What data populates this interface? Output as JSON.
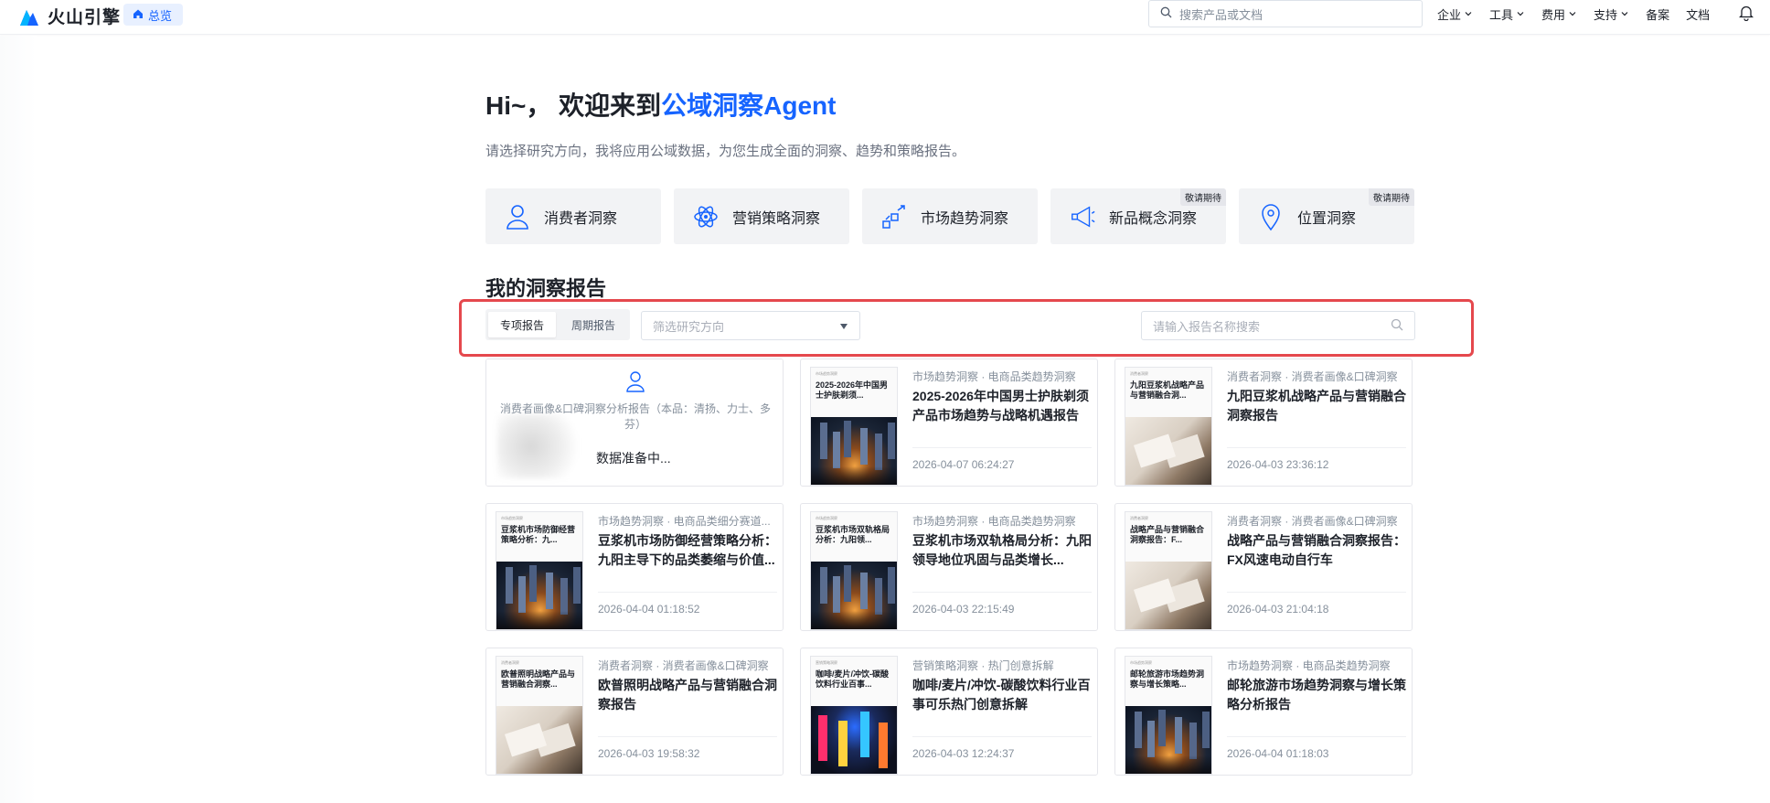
{
  "topbar": {
    "logo_text": "火山引擎",
    "home_label": "总览",
    "search_placeholder": "搜索产品或文档",
    "nav": [
      "企业",
      "工具",
      "费用",
      "支持"
    ],
    "links": [
      "备案",
      "文档"
    ]
  },
  "hero": {
    "greeting": "Hi~，  欢迎来到",
    "highlight": "公域洞察Agent",
    "subtitle": "请选择研究方向，我将应用公域数据，为您生成全面的洞察、趋势和策略报告。"
  },
  "features": [
    {
      "label": "消费者洞察",
      "icon": "person-icon",
      "badge": ""
    },
    {
      "label": "营销策略洞察",
      "icon": "atom-icon",
      "badge": ""
    },
    {
      "label": "市场趋势洞察",
      "icon": "trend-icon",
      "badge": ""
    },
    {
      "label": "新品概念洞察",
      "icon": "megaphone-icon",
      "badge": "敬请期待"
    },
    {
      "label": "位置洞察",
      "icon": "location-pin-icon",
      "badge": "敬请期待"
    }
  ],
  "reports_section": {
    "title": "我的洞察报告",
    "tabs": [
      "专项报告",
      "周期报告"
    ],
    "active_tab": "专项报告",
    "filter_placeholder": "筛选研究方向",
    "search_placeholder": "请输入报告名称搜索"
  },
  "pending_card": {
    "description": "消费者画像&口碑洞察分析报告（本品：清扬、力士、多芬）",
    "status": "数据准备中..."
  },
  "reports": [
    {
      "tags": "市场趋势洞察 · 电商品类趋势洞察",
      "title": "2025-2026年中国男士护肤剃须产品市场趋势与战略机遇报告",
      "thumb_title": "2025-2026年中国男士护肤剃须...",
      "date": "2026-04-07 06:24:27",
      "image": "city"
    },
    {
      "tags": "消费者洞察 · 消费者画像&口碑洞察",
      "title": "九阳豆浆机战略产品与营销融合洞察报告",
      "thumb_title": "九阳豆浆机战略产品与营销融合洞...",
      "date": "2026-04-03 23:36:12",
      "image": "office"
    },
    {
      "tags": "市场趋势洞察 · 电商品类细分赛道...",
      "title": "豆浆机市场防御经营策略分析：九阳主导下的品类萎缩与价值...",
      "thumb_title": "豆浆机市场防御经营策略分析：九...",
      "date": "2026-04-04 01:18:52",
      "image": "city"
    },
    {
      "tags": "市场趋势洞察 · 电商品类趋势洞察",
      "title": "豆浆机市场双轨格局分析：九阳领导地位巩固与品类增长...",
      "thumb_title": "豆浆机市场双轨格局分析：九阳领...",
      "date": "2026-04-03 22:15:49",
      "image": "city"
    },
    {
      "tags": "消费者洞察 · 消费者画像&口碑洞察",
      "title": "战略产品与营销融合洞察报告：FX风速电动自行车",
      "thumb_title": "战略产品与营销融合洞察报告：F...",
      "date": "2026-04-03 21:04:18",
      "image": "office"
    },
    {
      "tags": "消费者洞察 · 消费者画像&口碑洞察",
      "title": "欧普照明战略产品与营销融合洞察报告",
      "thumb_title": "欧普照明战略产品与营销融合洞察...",
      "date": "2026-04-03 19:58:32",
      "image": "office"
    },
    {
      "tags": "营销策略洞察 · 热门创意拆解",
      "title": "咖啡/麦片/冲饮-碳酸饮料行业百事可乐热门创意拆解",
      "thumb_title": "咖啡/麦片/冲饮-碳酸饮料行业百事...",
      "date": "2026-04-03 12:24:37",
      "image": "neon"
    },
    {
      "tags": "市场趋势洞察 · 电商品类趋势洞察",
      "title": "邮轮旅游市场趋势洞察与增长策略分析报告",
      "thumb_title": "邮轮旅游市场趋势洞察与增长策略...",
      "date": "2026-04-04 01:18:03",
      "image": "city"
    }
  ],
  "colors": {
    "accent": "#1664ff",
    "highlight_border": "#e5484d"
  }
}
